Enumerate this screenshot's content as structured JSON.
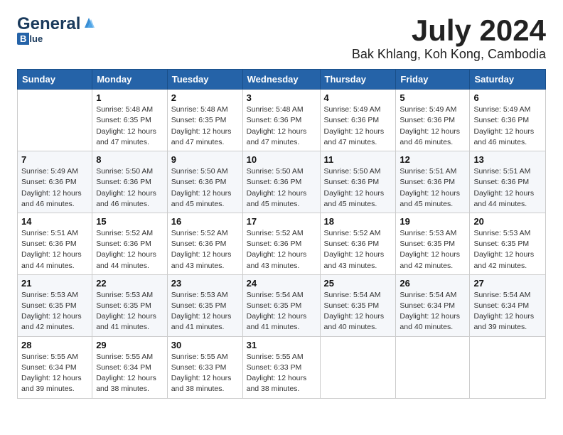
{
  "header": {
    "logo_general": "General",
    "logo_blue": "Blue",
    "month_year": "July 2024",
    "location": "Bak Khlang, Koh Kong, Cambodia"
  },
  "days_of_week": [
    "Sunday",
    "Monday",
    "Tuesday",
    "Wednesday",
    "Thursday",
    "Friday",
    "Saturday"
  ],
  "weeks": [
    [
      {
        "day": "",
        "info": ""
      },
      {
        "day": "1",
        "info": "Sunrise: 5:48 AM\nSunset: 6:35 PM\nDaylight: 12 hours\nand 47 minutes."
      },
      {
        "day": "2",
        "info": "Sunrise: 5:48 AM\nSunset: 6:35 PM\nDaylight: 12 hours\nand 47 minutes."
      },
      {
        "day": "3",
        "info": "Sunrise: 5:48 AM\nSunset: 6:36 PM\nDaylight: 12 hours\nand 47 minutes."
      },
      {
        "day": "4",
        "info": "Sunrise: 5:49 AM\nSunset: 6:36 PM\nDaylight: 12 hours\nand 47 minutes."
      },
      {
        "day": "5",
        "info": "Sunrise: 5:49 AM\nSunset: 6:36 PM\nDaylight: 12 hours\nand 46 minutes."
      },
      {
        "day": "6",
        "info": "Sunrise: 5:49 AM\nSunset: 6:36 PM\nDaylight: 12 hours\nand 46 minutes."
      }
    ],
    [
      {
        "day": "7",
        "info": ""
      },
      {
        "day": "8",
        "info": "Sunrise: 5:50 AM\nSunset: 6:36 PM\nDaylight: 12 hours\nand 46 minutes."
      },
      {
        "day": "9",
        "info": "Sunrise: 5:50 AM\nSunset: 6:36 PM\nDaylight: 12 hours\nand 45 minutes."
      },
      {
        "day": "10",
        "info": "Sunrise: 5:50 AM\nSunset: 6:36 PM\nDaylight: 12 hours\nand 45 minutes."
      },
      {
        "day": "11",
        "info": "Sunrise: 5:50 AM\nSunset: 6:36 PM\nDaylight: 12 hours\nand 45 minutes."
      },
      {
        "day": "12",
        "info": "Sunrise: 5:51 AM\nSunset: 6:36 PM\nDaylight: 12 hours\nand 45 minutes."
      },
      {
        "day": "13",
        "info": "Sunrise: 5:51 AM\nSunset: 6:36 PM\nDaylight: 12 hours\nand 44 minutes."
      }
    ],
    [
      {
        "day": "14",
        "info": ""
      },
      {
        "day": "15",
        "info": "Sunrise: 5:52 AM\nSunset: 6:36 PM\nDaylight: 12 hours\nand 44 minutes."
      },
      {
        "day": "16",
        "info": "Sunrise: 5:52 AM\nSunset: 6:36 PM\nDaylight: 12 hours\nand 43 minutes."
      },
      {
        "day": "17",
        "info": "Sunrise: 5:52 AM\nSunset: 6:36 PM\nDaylight: 12 hours\nand 43 minutes."
      },
      {
        "day": "18",
        "info": "Sunrise: 5:52 AM\nSunset: 6:36 PM\nDaylight: 12 hours\nand 43 minutes."
      },
      {
        "day": "19",
        "info": "Sunrise: 5:53 AM\nSunset: 6:35 PM\nDaylight: 12 hours\nand 42 minutes."
      },
      {
        "day": "20",
        "info": "Sunrise: 5:53 AM\nSunset: 6:35 PM\nDaylight: 12 hours\nand 42 minutes."
      }
    ],
    [
      {
        "day": "21",
        "info": ""
      },
      {
        "day": "22",
        "info": "Sunrise: 5:53 AM\nSunset: 6:35 PM\nDaylight: 12 hours\nand 41 minutes."
      },
      {
        "day": "23",
        "info": "Sunrise: 5:53 AM\nSunset: 6:35 PM\nDaylight: 12 hours\nand 41 minutes."
      },
      {
        "day": "24",
        "info": "Sunrise: 5:54 AM\nSunset: 6:35 PM\nDaylight: 12 hours\nand 41 minutes."
      },
      {
        "day": "25",
        "info": "Sunrise: 5:54 AM\nSunset: 6:35 PM\nDaylight: 12 hours\nand 40 minutes."
      },
      {
        "day": "26",
        "info": "Sunrise: 5:54 AM\nSunset: 6:34 PM\nDaylight: 12 hours\nand 40 minutes."
      },
      {
        "day": "27",
        "info": "Sunrise: 5:54 AM\nSunset: 6:34 PM\nDaylight: 12 hours\nand 39 minutes."
      }
    ],
    [
      {
        "day": "28",
        "info": "Sunrise: 5:55 AM\nSunset: 6:34 PM\nDaylight: 12 hours\nand 39 minutes."
      },
      {
        "day": "29",
        "info": "Sunrise: 5:55 AM\nSunset: 6:34 PM\nDaylight: 12 hours\nand 38 minutes."
      },
      {
        "day": "30",
        "info": "Sunrise: 5:55 AM\nSunset: 6:33 PM\nDaylight: 12 hours\nand 38 minutes."
      },
      {
        "day": "31",
        "info": "Sunrise: 5:55 AM\nSunset: 6:33 PM\nDaylight: 12 hours\nand 38 minutes."
      },
      {
        "day": "",
        "info": ""
      },
      {
        "day": "",
        "info": ""
      },
      {
        "day": "",
        "info": ""
      }
    ]
  ],
  "week7_sunday_info": "Sunrise: 5:49 AM\nSunset: 6:36 PM\nDaylight: 12 hours\nand 46 minutes.",
  "week14_sunday_info": "Sunrise: 5:51 AM\nSunset: 6:36 PM\nDaylight: 12 hours\nand 44 minutes.",
  "week21_sunday_info": "Sunrise: 5:52 AM\nSunset: 6:36 PM\nDaylight: 12 hours\nand 43 minutes.",
  "week21_sun_info": "Sunrise: 5:53 AM\nSunset: 6:35 PM\nDaylight: 12 hours\nand 42 minutes."
}
